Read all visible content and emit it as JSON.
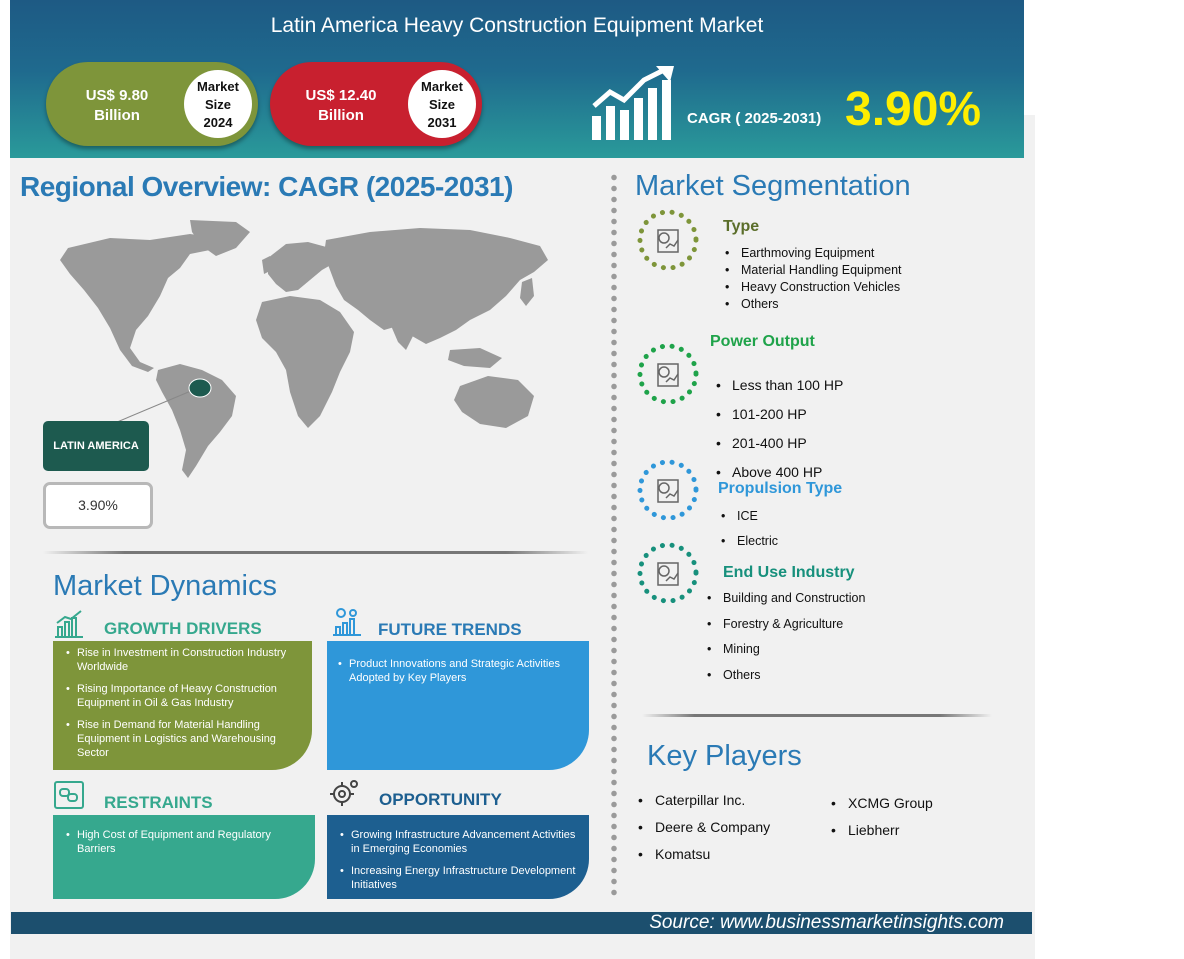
{
  "header": {
    "title": "Latin America Heavy Construction Equipment Market",
    "market_2024": {
      "value": "US$ 9.80",
      "unit": "Billion",
      "label_line1": "Market",
      "label_line2": "Size",
      "year": "2024"
    },
    "market_2031": {
      "value": "US$ 12.40",
      "unit": "Billion",
      "label_line1": "Market",
      "label_line2": "Size",
      "year": "2031"
    },
    "cagr_label": "CAGR ( 2025-2031)",
    "cagr_value": "3.90%"
  },
  "regional": {
    "title": "Regional Overview: CAGR (2025-2031)",
    "region_name": "LATIN AMERICA",
    "region_cagr": "3.90%"
  },
  "dynamics": {
    "title": "Market Dynamics",
    "growth_drivers": {
      "heading": "GROWTH DRIVERS",
      "items": [
        "Rise in Investment in Construction Industry Worldwide",
        "Rising Importance of Heavy Construction Equipment in Oil & Gas Industry",
        "Rise in Demand for Material Handling Equipment in Logistics and Warehousing Sector"
      ]
    },
    "future_trends": {
      "heading": "FUTURE TRENDS",
      "items": [
        "Product Innovations and Strategic Activities Adopted by Key Players"
      ]
    },
    "restraints": {
      "heading": "RESTRAINTS",
      "items": [
        "High Cost of Equipment and Regulatory Barriers"
      ]
    },
    "opportunity": {
      "heading": "OPPORTUNITY",
      "items": [
        "Growing Infrastructure Advancement Activities in Emerging Economies",
        "Increasing Energy Infrastructure Development Initiatives"
      ]
    }
  },
  "segmentation": {
    "title": "Market Segmentation",
    "type": {
      "heading": "Type",
      "items": [
        "Earthmoving Equipment",
        "Material Handling Equipment",
        "Heavy Construction Vehicles",
        "Others"
      ]
    },
    "power_output": {
      "heading": "Power Output",
      "items": [
        "Less than 100 HP",
        "101-200 HP",
        "201-400 HP",
        "Above 400 HP"
      ]
    },
    "propulsion_type": {
      "heading": "Propulsion Type",
      "items": [
        "ICE",
        "Electric"
      ]
    },
    "end_use": {
      "heading": "End Use Industry",
      "items": [
        "Building and Construction",
        "Forestry & Agriculture",
        "Mining",
        "Others"
      ]
    }
  },
  "key_players": {
    "title": "Key Players",
    "col1": [
      "Caterpillar Inc.",
      "Deere & Company",
      "Komatsu"
    ],
    "col2": [
      "XCMG Group",
      "Liebherr"
    ]
  },
  "footer": {
    "source": "Source: www.businessmarketinsights.com"
  },
  "colors": {
    "header_dark": "#1e5a84",
    "header_teal": "#2a9a9a",
    "olive": "#7e953a",
    "red": "#c8202f",
    "cagr_yellow": "#ffee00",
    "title_blue": "#2a7ab5",
    "trends_blue": "#2f97d9",
    "restraints_teal": "#36a88e",
    "opportunity_navy": "#1d5f90",
    "region_green": "#1d5a4f"
  }
}
